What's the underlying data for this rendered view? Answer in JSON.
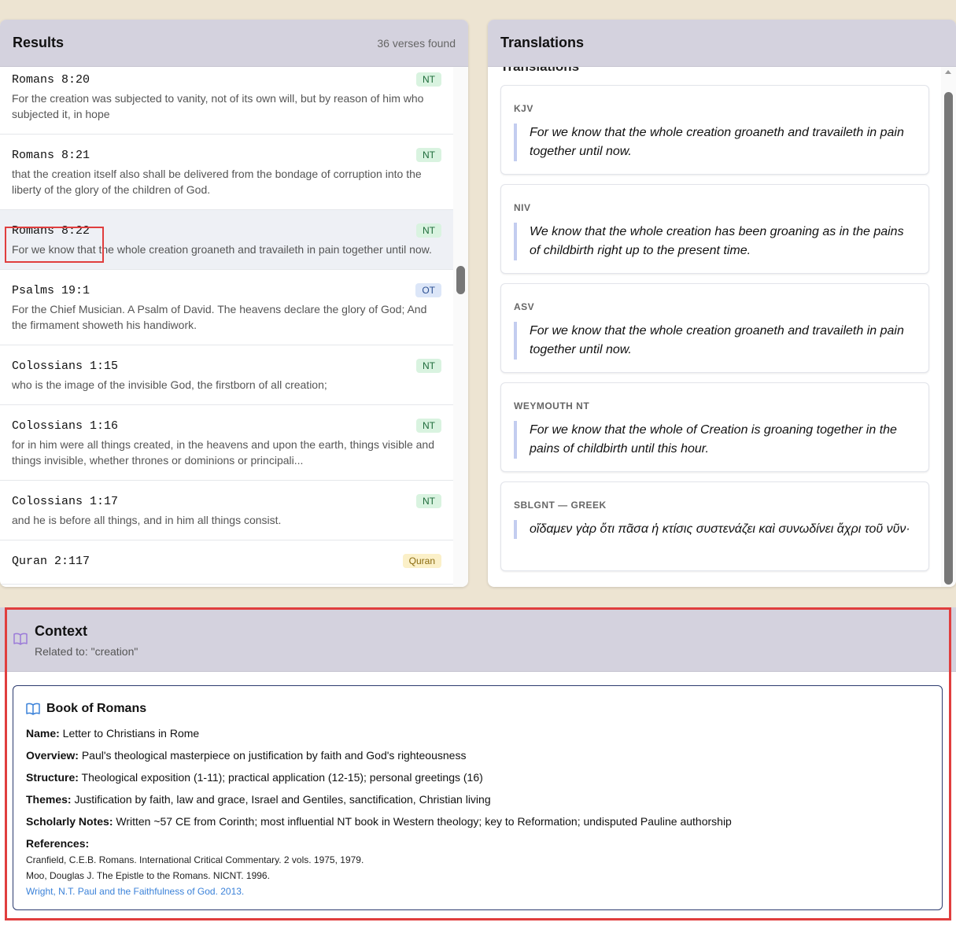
{
  "results": {
    "title": "Results",
    "count": "36 verses found",
    "items": [
      {
        "ref": "Romans 8:20",
        "badge": "NT",
        "text": "For the creation was subjected to vanity, not of its own will, but by reason of him who subjected it, in hope"
      },
      {
        "ref": "Romans 8:21",
        "badge": "NT",
        "text": "that the creation itself also shall be delivered from the bondage of corruption into the liberty of the glory of the children of God."
      },
      {
        "ref": "Romans 8:22",
        "badge": "NT",
        "text": "For we know that the whole creation groaneth and travaileth in pain together until now."
      },
      {
        "ref": "Psalms 19:1",
        "badge": "OT",
        "text": "For the Chief Musician. A Psalm of David. The heavens declare the glory of God; And the firmament showeth his handiwork."
      },
      {
        "ref": "Colossians 1:15",
        "badge": "NT",
        "text": "who is the image of the invisible God, the firstborn of all creation;"
      },
      {
        "ref": "Colossians 1:16",
        "badge": "NT",
        "text": "for in him were all things created, in the heavens and upon the earth, things visible and things invisible, whether thrones or dominions or principali..."
      },
      {
        "ref": "Colossians 1:17",
        "badge": "NT",
        "text": "and he is before all things, and in him all things consist."
      },
      {
        "ref": "Quran 2:117",
        "badge": "Quran",
        "text": ""
      }
    ]
  },
  "translations": {
    "title": "Translations",
    "peek_label": "Translations",
    "cards": [
      {
        "label": "KJV",
        "text": "For we know that the whole creation groaneth and travaileth in pain together until now."
      },
      {
        "label": "NIV",
        "text": "We know that the whole creation has been groaning as in the pains of childbirth right up to the present time."
      },
      {
        "label": "ASV",
        "text": "For we know that the whole creation groaneth and travaileth in pain together until now."
      },
      {
        "label": "WEYMOUTH NT",
        "text": "For we know that the whole of Creation is groaning together in the pains of childbirth until this hour."
      },
      {
        "label": "SBLGNT — GREEK",
        "text": "οἴδαμεν γὰρ ὅτι πᾶσα ἡ κτίσις συστενάζει καὶ συνωδίνει ἄχρι τοῦ νῦν·"
      }
    ]
  },
  "context": {
    "title": "Context",
    "subtitle": "Related to: \"creation\"",
    "book": {
      "title": "Book of Romans",
      "fields": [
        {
          "label": "Name:",
          "value": " Letter to Christians in Rome"
        },
        {
          "label": "Overview:",
          "value": " Paul's theological masterpiece on justification by faith and God's righteousness"
        },
        {
          "label": "Structure:",
          "value": " Theological exposition (1-11); practical application (12-15); personal greetings (16)"
        },
        {
          "label": "Themes:",
          "value": " Justification by faith, law and grace, Israel and Gentiles, sanctification, Christian living"
        },
        {
          "label": "Scholarly Notes:",
          "value": " Written ~57 CE from Corinth; most influential NT book in Western theology; key to Reformation; undisputed Pauline authorship"
        }
      ],
      "references_label": "References:",
      "references": [
        "Cranfield, C.E.B. Romans. International Critical Commentary. 2 vols. 1975, 1979.",
        "Moo, Douglas J. The Epistle to the Romans. NICNT. 1996.",
        "Wright, N.T. Paul and the Faithfulness of God. 2013."
      ]
    }
  },
  "colors": {
    "background": "#ede4d2",
    "header": "#d4d2de",
    "highlight": "#e03e3e",
    "link": "#3b82d9",
    "icon_purple": "#9b7bd8",
    "icon_blue": "#3b82d9"
  },
  "icons": {
    "context_icon": "open-book-icon",
    "book_icon": "open-book-icon"
  }
}
